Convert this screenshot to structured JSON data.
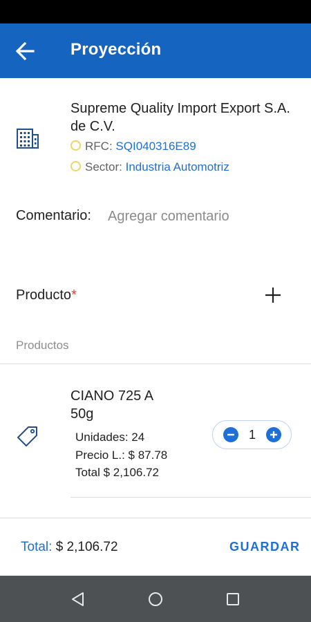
{
  "appbar": {
    "title": "Proyección",
    "back_icon": "arrow-left-icon",
    "color": "#1565c0"
  },
  "company": {
    "icon": "building-icon",
    "name": "Supreme Quality Import Export S.A. de C.V.",
    "rfc_label": "RFC:",
    "rfc_value": "SQI040316E89",
    "sector_label": "Sector:",
    "sector_value": "Industria Automotriz",
    "status_dot_color": "#f2d45c"
  },
  "comment": {
    "label": "Comentario:",
    "placeholder": "Agregar comentario",
    "value": ""
  },
  "product_field": {
    "label": "Producto",
    "required_mark": "*",
    "add_icon": "plus-icon"
  },
  "products_section": {
    "header": "Productos",
    "items": [
      {
        "icon": "tag-icon",
        "name": "CIANO 725 A 50g",
        "units": "Unidades: 24",
        "price": "Precio L.: $ 87.78",
        "total": "Total $ 2,106.72",
        "quantity": "1"
      }
    ]
  },
  "footer": {
    "total_label": "Total:",
    "total_value": "$ 2,106.72",
    "save_label": "GUARDAR",
    "accent": "#1e6fd6"
  },
  "navbar": {
    "back_icon": "nav-back-triangle-icon",
    "home_icon": "nav-home-circle-icon",
    "recents_icon": "nav-recents-square-icon"
  }
}
